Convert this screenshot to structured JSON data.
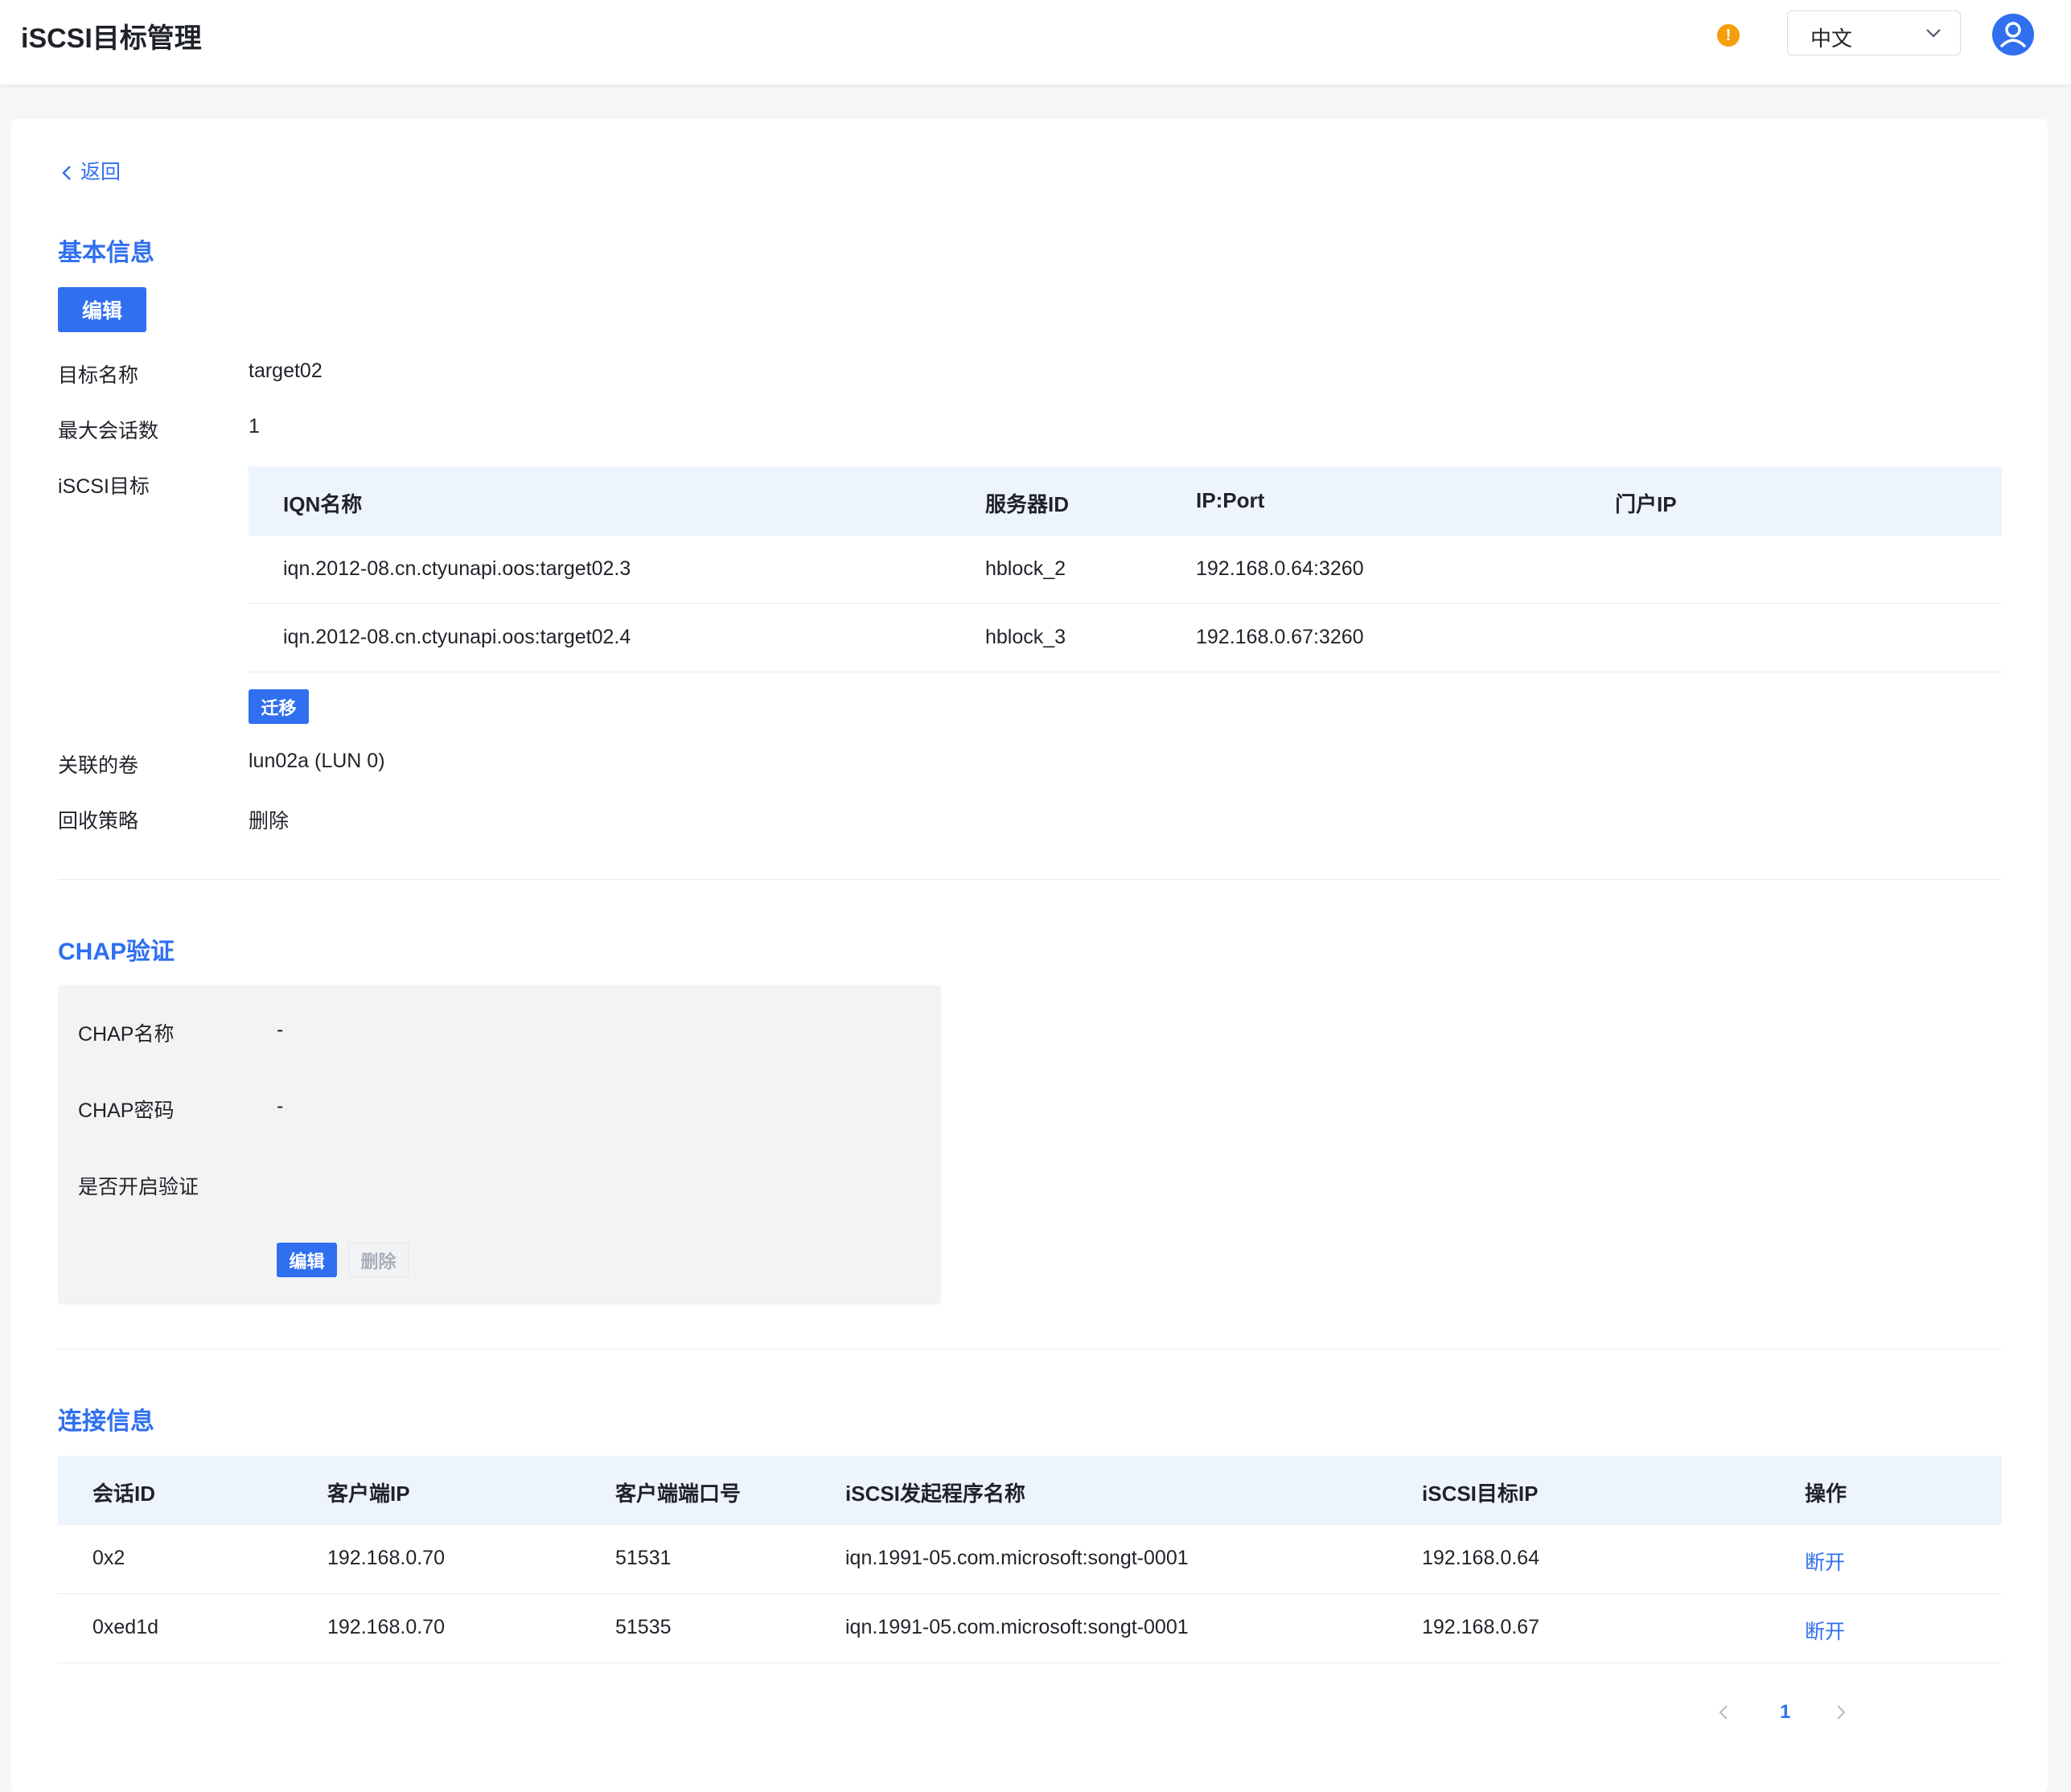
{
  "header": {
    "title": "iSCSI目标管理",
    "language": "中文",
    "accent_color": "#2f6ff0",
    "alert_color": "#f59e0b"
  },
  "back": {
    "label": "返回"
  },
  "basic_info": {
    "title": "基本信息",
    "edit_label": "编辑",
    "target_name_label": "目标名称",
    "target_name_value": "target02",
    "max_sessions_label": "最大会话数",
    "max_sessions_value": "1",
    "iscsi_target_label": "iSCSI目标",
    "table": {
      "headers": [
        "IQN名称",
        "服务器ID",
        "IP:Port",
        "门户IP"
      ],
      "rows": [
        [
          "iqn.2012-08.cn.ctyunapi.oos:target02.3",
          "hblock_2",
          "192.168.0.64:3260",
          ""
        ],
        [
          "iqn.2012-08.cn.ctyunapi.oos:target02.4",
          "hblock_3",
          "192.168.0.67:3260",
          ""
        ]
      ]
    },
    "migrate_label": "迁移",
    "volume_label": "关联的卷",
    "volume_value": "lun02a (LUN 0)",
    "reclaim_label": "回收策略",
    "reclaim_value": "删除"
  },
  "chap": {
    "title": "CHAP验证",
    "name_label": "CHAP名称",
    "name_value": "-",
    "password_label": "CHAP密码",
    "password_value": "-",
    "enabled_label": "是否开启验证",
    "edit_label": "编辑",
    "delete_label": "删除"
  },
  "connections": {
    "title": "连接信息",
    "headers": [
      "会话ID",
      "客户端IP",
      "客户端端口号",
      "iSCSI发起程序名称",
      "iSCSI目标IP",
      "操作"
    ],
    "rows": [
      [
        "0x2",
        "192.168.0.70",
        "51531",
        "iqn.1991-05.com.microsoft:songt-0001",
        "192.168.0.64",
        "断开"
      ],
      [
        "0xed1d",
        "192.168.0.70",
        "51535",
        "iqn.1991-05.com.microsoft:songt-0001",
        "192.168.0.67",
        "断开"
      ]
    ]
  },
  "pagination": {
    "current_page": "1"
  }
}
